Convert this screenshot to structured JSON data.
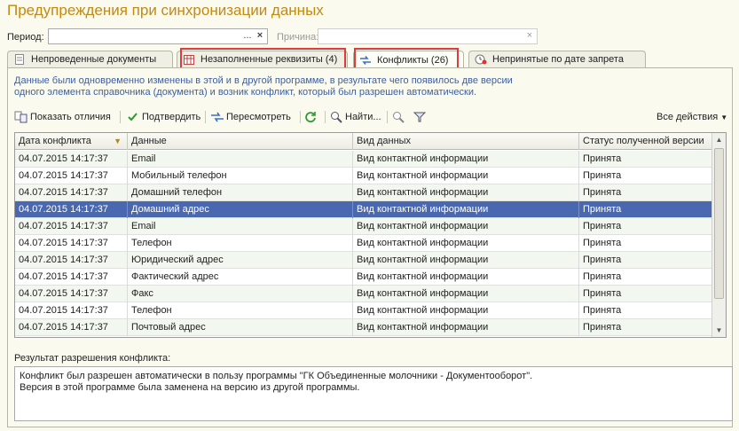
{
  "title": "Предупреждения при синхронизации данных",
  "filters": {
    "period_label": "Период:",
    "period_value": "",
    "period_btn": "...",
    "period_clear": "×",
    "reason_label": "Причина:",
    "reason_value": "",
    "reason_clear": "×"
  },
  "tabs": [
    {
      "label": "Непроведенные документы"
    },
    {
      "label": "Незаполненные реквизиты (4)"
    },
    {
      "label": "Конфликты (26)"
    },
    {
      "label": "Непринятые по дате запрета"
    }
  ],
  "description_line1": "Данные были одновременно изменены в этой и в другой программе, в результате чего появилось две версии",
  "description_line2": "одного элемента справочника (документа) и возник конфликт, который был разрешен автоматически.",
  "toolbar": {
    "show_diff": "Показать отличия",
    "confirm": "Подтвердить",
    "reconsider": "Пересмотреть",
    "find": "Найти...",
    "all_actions": "Все действия"
  },
  "table": {
    "columns": [
      "Дата конфликта",
      "Данные",
      "Вид данных",
      "Статус полученной версии"
    ],
    "rows": [
      [
        "04.07.2015 14:17:37",
        "Email",
        "Вид контактной информации",
        "Принята"
      ],
      [
        "04.07.2015 14:17:37",
        "Мобильный телефон",
        "Вид контактной информации",
        "Принята"
      ],
      [
        "04.07.2015 14:17:37",
        "Домашний телефон",
        "Вид контактной информации",
        "Принята"
      ],
      [
        "04.07.2015 14:17:37",
        "Домашний адрес",
        "Вид контактной информации",
        "Принята"
      ],
      [
        "04.07.2015 14:17:37",
        "Email",
        "Вид контактной информации",
        "Принята"
      ],
      [
        "04.07.2015 14:17:37",
        "Телефон",
        "Вид контактной информации",
        "Принята"
      ],
      [
        "04.07.2015 14:17:37",
        "Юридический адрес",
        "Вид контактной информации",
        "Принята"
      ],
      [
        "04.07.2015 14:17:37",
        "Фактический адрес",
        "Вид контактной информации",
        "Принята"
      ],
      [
        "04.07.2015 14:17:37",
        "Факс",
        "Вид контактной информации",
        "Принята"
      ],
      [
        "04.07.2015 14:17:37",
        "Телефон",
        "Вид контактной информации",
        "Принята"
      ],
      [
        "04.07.2015 14:17:37",
        "Почтовый адрес",
        "Вид контактной информации",
        "Принята"
      ]
    ],
    "selected_row": 3
  },
  "result": {
    "label": "Результат разрешения конфликта:",
    "line1": "Конфликт был разрешен автоматически в пользу программы \"ГК Объединенные молочники - Документооборот\".",
    "line2": "Версия в этой программе была заменена на версию из другой программы."
  },
  "colors": {
    "title": "#c28a10",
    "description": "#3b5fa0",
    "highlight_box": "#e03a3a",
    "selected_row": "#4a68b0"
  }
}
